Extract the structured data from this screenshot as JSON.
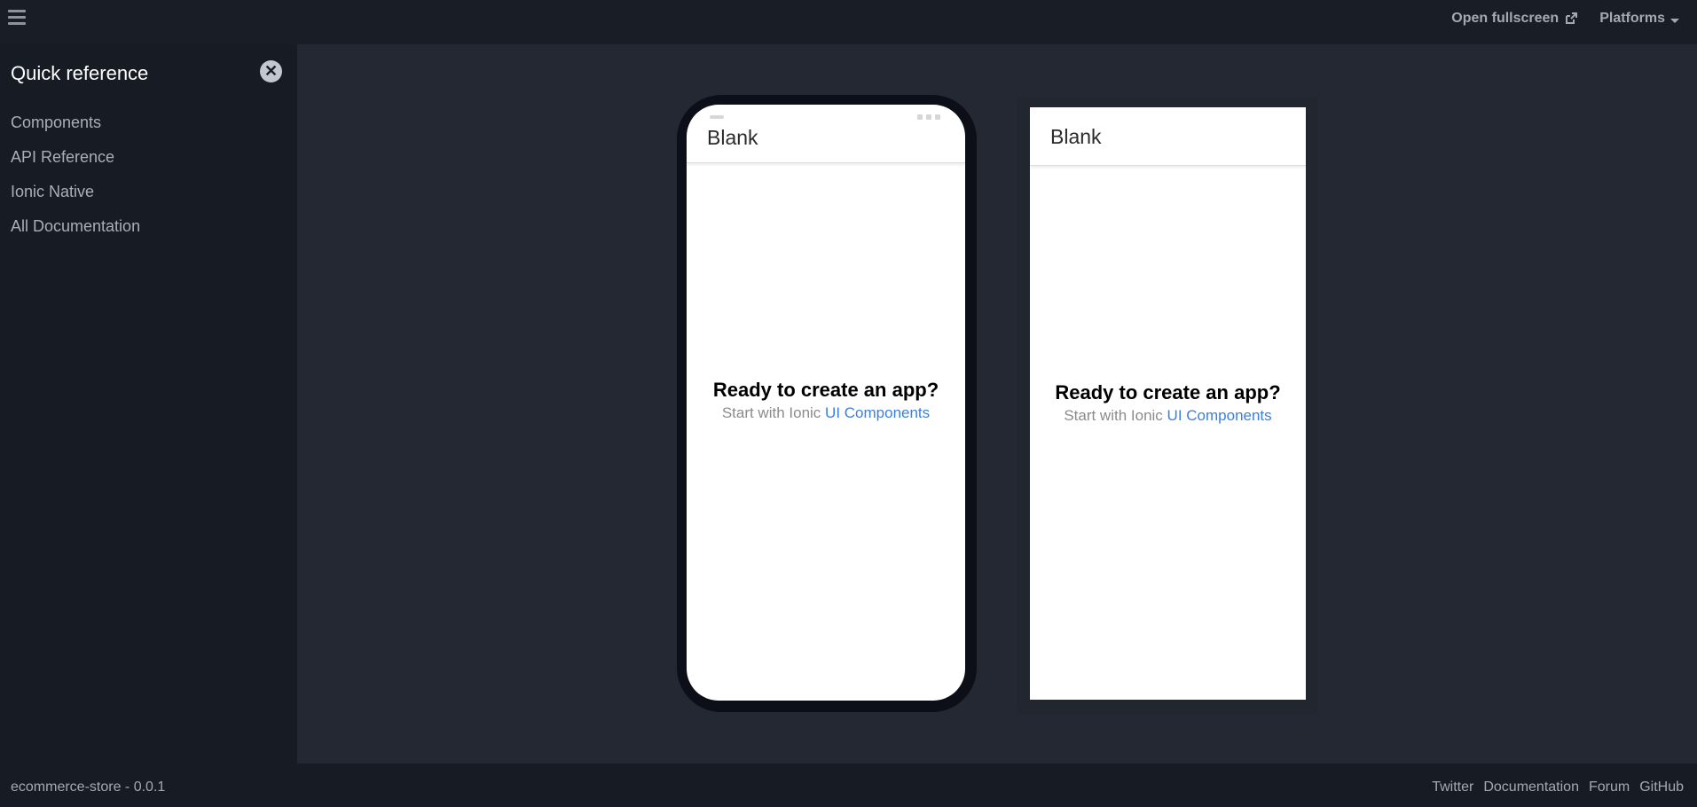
{
  "topbar": {
    "open_fullscreen": "Open fullscreen",
    "platforms": "Platforms"
  },
  "sidebar": {
    "title": "Quick reference",
    "items": [
      {
        "label": "Components"
      },
      {
        "label": "API Reference"
      },
      {
        "label": "Ionic Native"
      },
      {
        "label": "All Documentation"
      }
    ]
  },
  "ios_preview": {
    "header_title": "Blank",
    "heading": "Ready to create an app?",
    "subtext": "Start with Ionic",
    "link": "UI Components"
  },
  "android_preview": {
    "header_title": "Blank",
    "heading": "Ready to create an app?",
    "subtext": "Start with Ionic",
    "link": "UI Components"
  },
  "footer": {
    "project": "ecommerce-store - 0.0.1",
    "links": [
      "Twitter",
      "Documentation",
      "Forum",
      "GitHub"
    ]
  },
  "icons": {
    "menu": "hamburger-icon",
    "external": "external-link-icon",
    "dropdown": "chevron-down-icon",
    "close": "close-icon"
  },
  "colors": {
    "background": "#242832",
    "sidebar": "#171b24",
    "link": "#3b7fe0"
  }
}
